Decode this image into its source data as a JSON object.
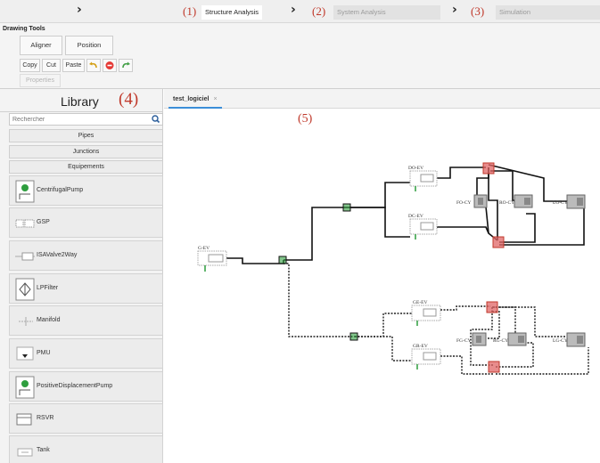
{
  "stepbar": {
    "steps": [
      {
        "num": "(1)",
        "label": "Structure Analysis",
        "active": true
      },
      {
        "num": "(2)",
        "label": "System Analysis",
        "active": false
      },
      {
        "num": "(3)",
        "label": "Simulation",
        "active": false
      }
    ],
    "arrow": "›",
    "accent": "#c0392b"
  },
  "ribbon": {
    "title": "Drawing Tools",
    "aligner_label": "Aligner",
    "position_label": "Position",
    "copy_label": "Copy",
    "cut_label": "Cut",
    "paste_label": "Paste",
    "properties_label": "Properties",
    "icons": [
      "undo-icon",
      "stop-icon",
      "redo-icon"
    ]
  },
  "library": {
    "title": "Library",
    "annotation": "(4)",
    "search_placeholder": "Rechercher",
    "categories": [
      "Pipes",
      "Junctions",
      "Equipements"
    ],
    "items": [
      "CentrifugalPump",
      "GSP",
      "ISAValve2Way",
      "LPFilter",
      "Manifold",
      "PMU",
      "PositiveDisplacementPump",
      "RSVR",
      "Tank"
    ]
  },
  "editor": {
    "tab_label": "test_logiciel",
    "tab_close": "×",
    "annotation": "(5)"
  },
  "diagram": {
    "components": [
      "G-EV",
      "DO-EV",
      "DC-EV",
      "FO-CY",
      "RO-CY",
      "LO-CY",
      "GE-EV",
      "GR-EV",
      "FG-CY",
      "RG-CY",
      "LG-CY"
    ],
    "colors": {
      "pipe_solid": "#111111",
      "pipe_dashed": "#222222",
      "junction": "#e06666",
      "port": "#2e9e3e",
      "component": "#888888"
    }
  }
}
